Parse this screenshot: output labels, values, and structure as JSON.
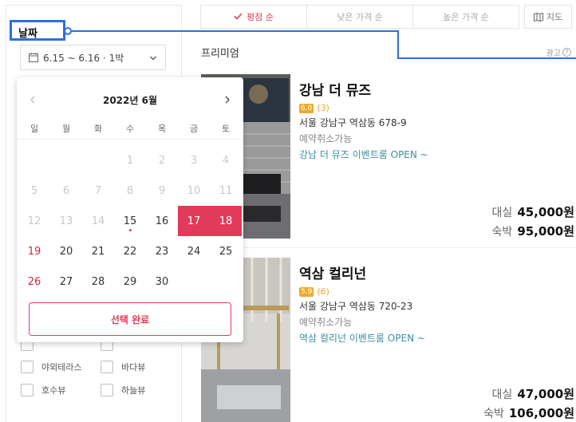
{
  "filter": {
    "highlight_label": "날짜",
    "date_range": "6.15 ~ 6.16 · 1박",
    "checkboxes": [
      {
        "label": "야외테라스"
      },
      {
        "label": "바다뷰"
      },
      {
        "label": "호수뷰"
      },
      {
        "label": "하늘뷰"
      }
    ]
  },
  "calendar": {
    "title": "2022년 6월",
    "weekdays": [
      "일",
      "월",
      "화",
      "수",
      "목",
      "금",
      "토"
    ],
    "done_label": "선택 완료",
    "weeks": [
      [
        "",
        "",
        "",
        "1",
        "2",
        "3",
        "4"
      ],
      [
        "5",
        "6",
        "7",
        "8",
        "9",
        "10",
        "11"
      ],
      [
        "12",
        "13",
        "14",
        "15",
        "16",
        "17",
        "18"
      ],
      [
        "19",
        "20",
        "21",
        "22",
        "23",
        "24",
        "25"
      ],
      [
        "26",
        "27",
        "28",
        "29",
        "30",
        "",
        ""
      ]
    ],
    "last_disabled_day": 14,
    "today": 15,
    "selected": [
      17,
      18
    ]
  },
  "sort": {
    "options": [
      {
        "label": "평점 순",
        "active": true
      },
      {
        "label": "낮은 가격 순",
        "active": false
      },
      {
        "label": "높은 가격 순",
        "active": false
      }
    ],
    "map_label": "지도"
  },
  "section": {
    "title": "프리미엄",
    "ad_label": "광고"
  },
  "listings": [
    {
      "name": "강남 더 뮤즈",
      "score": "6.0",
      "reviews": "(3)",
      "address": "서울 강남구 역삼동 678-9",
      "cancel": "예약취소가능",
      "event": "강남 더 뮤즈 이벤트룸 OPEN ~",
      "rent_label": "대실",
      "rent_price": "45,000원",
      "stay_label": "숙박",
      "stay_price": "95,000원"
    },
    {
      "name": "역삼 컬리넌",
      "score": "5.9",
      "reviews": "(6)",
      "address": "서울 강남구 역삼동 720-23",
      "cancel": "예약취소가능",
      "event": "역삼 컬리넌 이벤트룸 OPEN ~",
      "rent_label": "대실",
      "rent_price": "47,000원",
      "stay_label": "숙박",
      "stay_price": "106,000원"
    }
  ],
  "colors": {
    "accent": "#e23b59",
    "highlight": "#2f6fe0",
    "rating": "#f0a92b",
    "event": "#3a8fa0"
  }
}
